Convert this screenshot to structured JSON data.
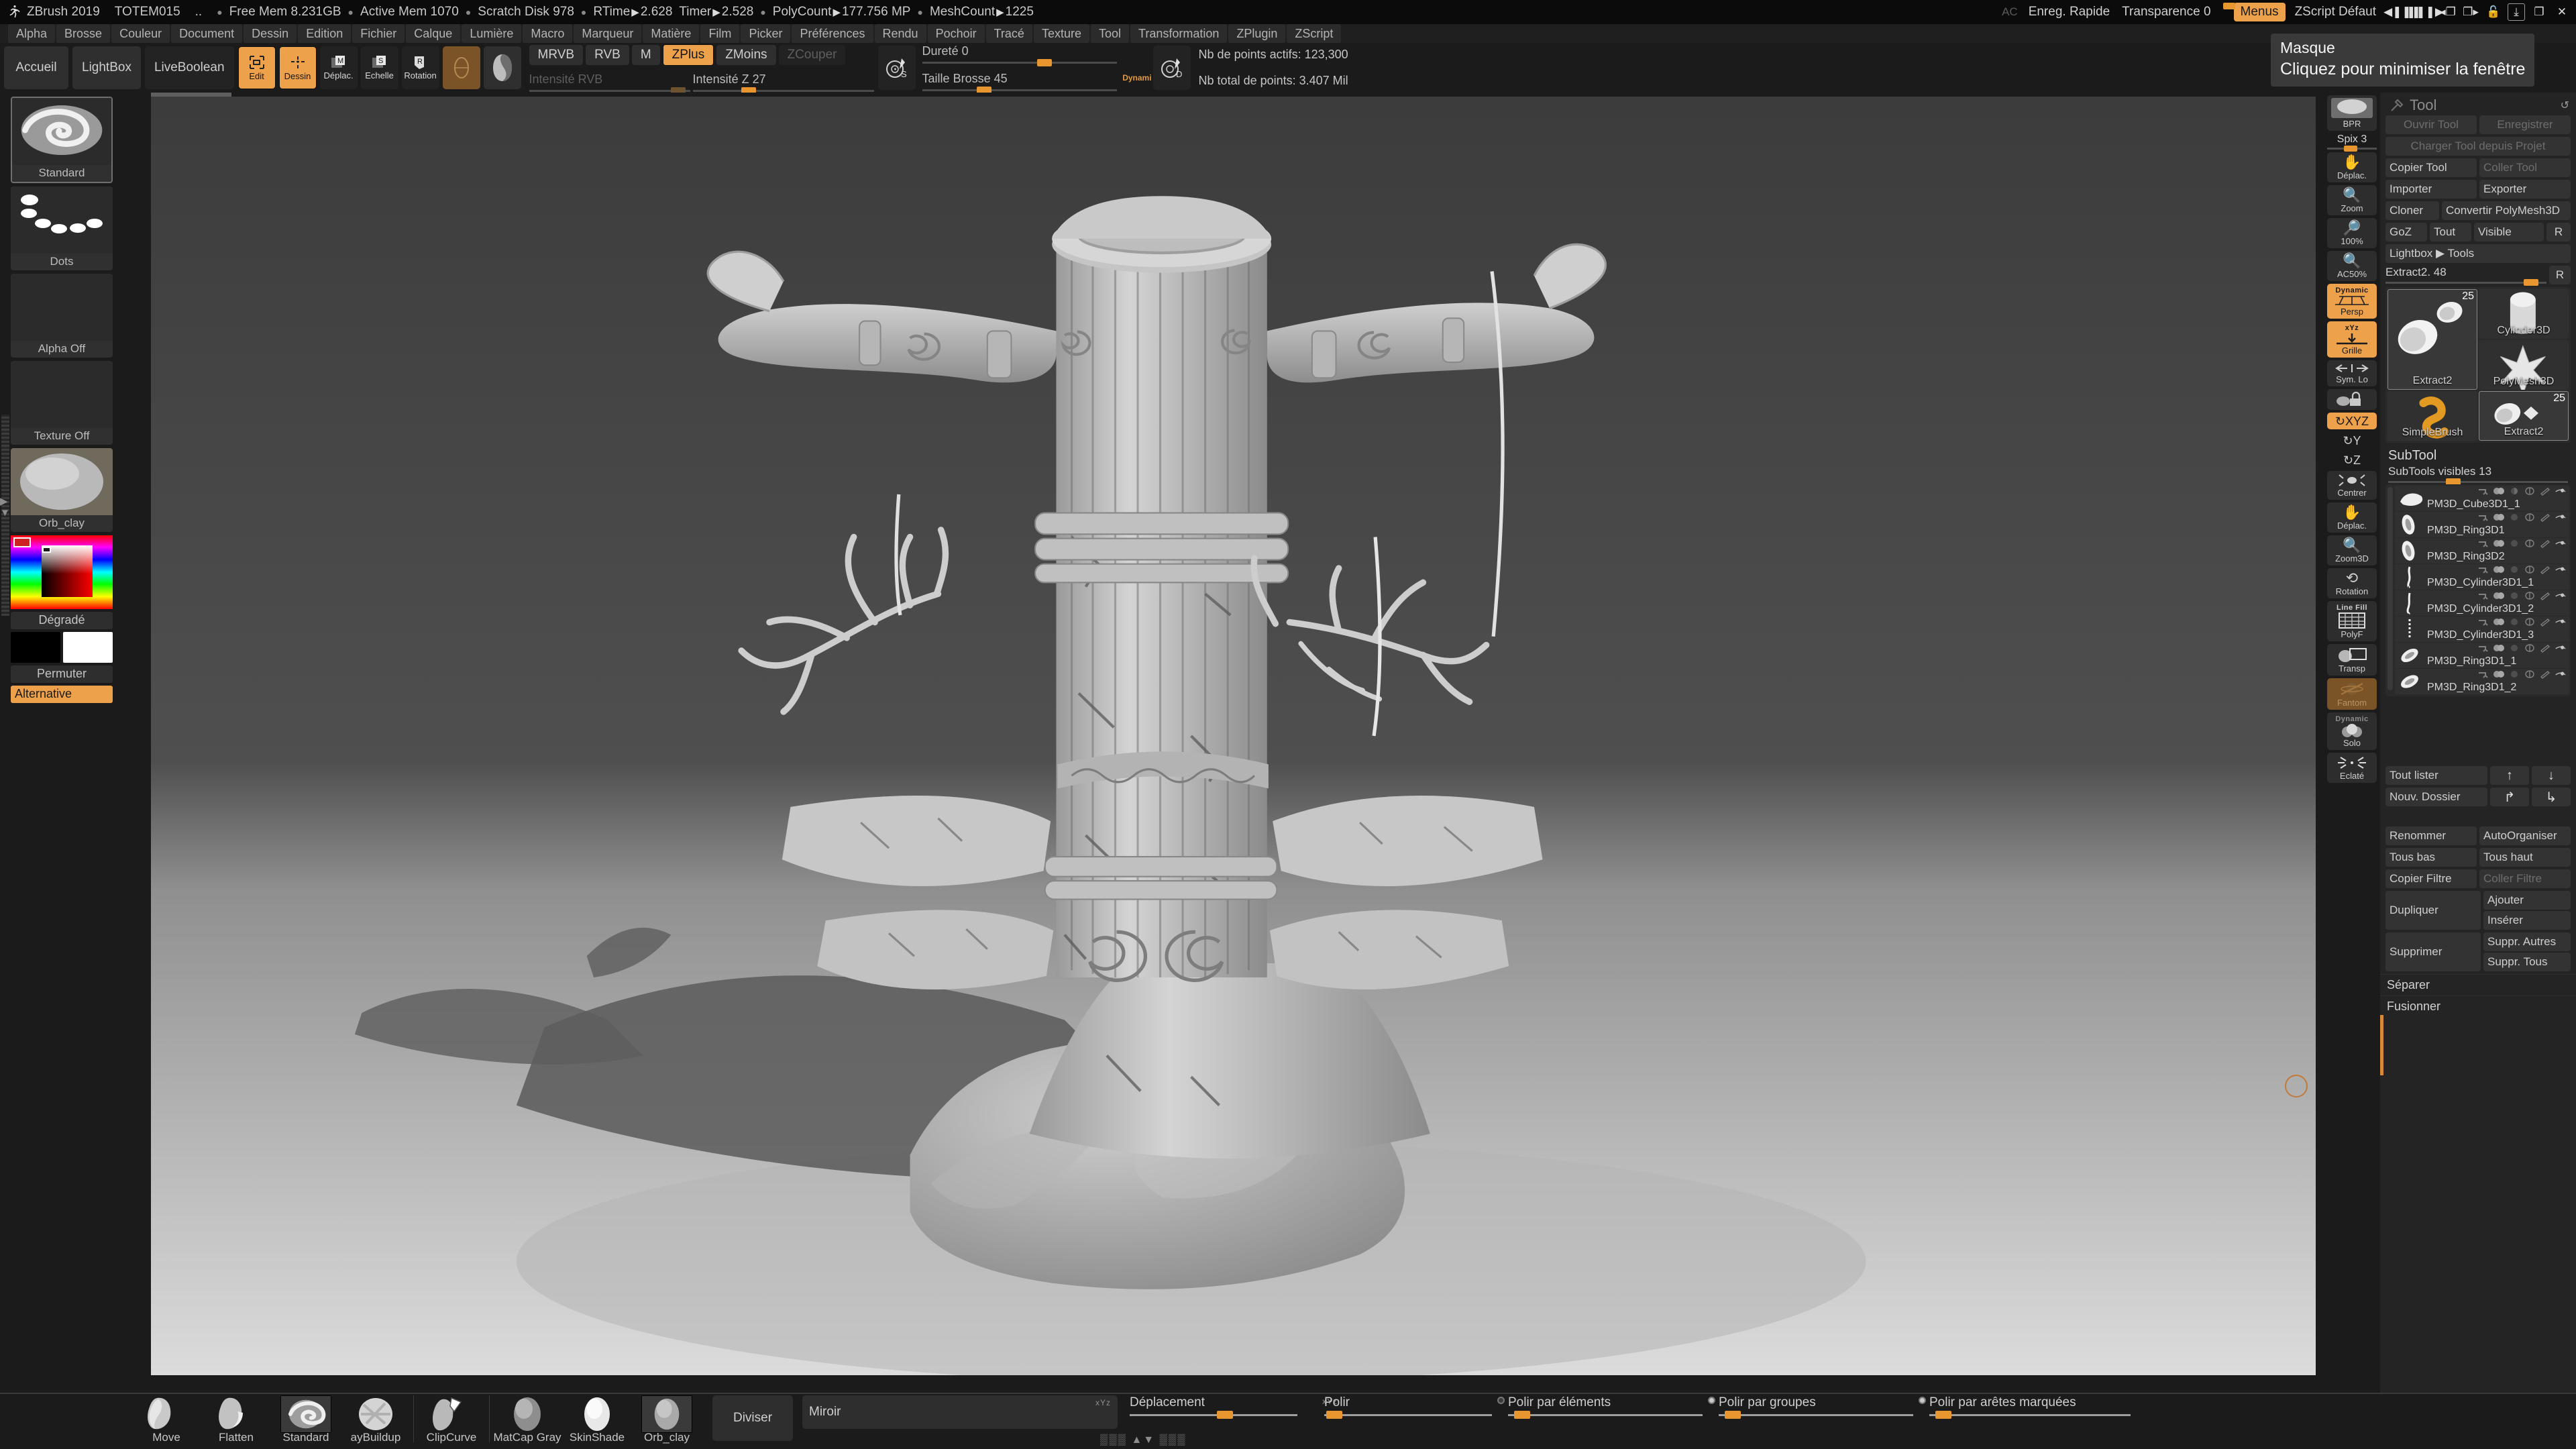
{
  "titlebar": {
    "app": "ZBrush 2019",
    "document": "TOTEM015",
    "ellipsis": "..",
    "stats": [
      {
        "label": "Free Mem",
        "value": "8.231GB"
      },
      {
        "label": "Active Mem",
        "value": "1070"
      },
      {
        "label": "Scratch Disk",
        "value": "978"
      }
    ],
    "timers": [
      {
        "label": "RTime",
        "value": "2.628"
      },
      {
        "label": "Timer",
        "value": "2.528"
      },
      {
        "label": "PolyCount",
        "value": "177.756 MP"
      },
      {
        "label": "MeshCount",
        "value": "1225"
      }
    ],
    "ac": "AC",
    "quicksave": "Enreg. Rapide",
    "transparency_label": "Transparence 0",
    "menus": "Menus",
    "zscript": "ZScript Défaut"
  },
  "menubar": {
    "items": [
      "Alpha",
      "Brosse",
      "Couleur",
      "Document",
      "Dessin",
      "Edition",
      "Fichier",
      "Calque",
      "Lumière",
      "Macro",
      "Marqueur",
      "Matière",
      "Film",
      "Picker",
      "Préférences",
      "Rendu",
      "Pochoir",
      "Tracé",
      "Texture",
      "Tool",
      "Transformation",
      "ZPlugin",
      "ZScript"
    ]
  },
  "topshelf": {
    "buttons": [
      "Accueil",
      "LightBox",
      "LiveBoolean"
    ],
    "mode_icons": [
      {
        "label": "Edit",
        "icon": "edit-icon",
        "active": true
      },
      {
        "label": "Dessin",
        "icon": "draw-icon",
        "active": true
      },
      {
        "label": "Déplac.",
        "icon": "move-icon",
        "active": false
      },
      {
        "label": "Echelle",
        "icon": "scale-icon",
        "active": false
      },
      {
        "label": "Rotation",
        "icon": "rotate-icon",
        "active": false
      }
    ],
    "color_modes": [
      "MRVB",
      "RVB",
      "M"
    ],
    "z_modes": [
      {
        "label": "ZPlus",
        "active": true
      },
      {
        "label": "ZMoins",
        "active": false
      },
      {
        "label": "ZCouper",
        "active": false,
        "disabled": true
      }
    ],
    "rgb_intensity_label": "Intensité RVB",
    "z_intensity_label": "Intensité Z 27",
    "hardness_label": "Dureté 0",
    "brush_size_label": "Taille Brosse 45",
    "dynamic_label": "Dynami",
    "active_points": "Nb de points actifs: 123,300",
    "total_points": "Nb total de points: 3.407 Mil"
  },
  "lefttray": {
    "cells": [
      {
        "name": "Standard",
        "type": "brush",
        "selected": true
      },
      {
        "name": "Dots",
        "type": "stroke"
      },
      {
        "name": "Alpha Off",
        "type": "alpha"
      },
      {
        "name": "Texture Off",
        "type": "texture"
      },
      {
        "name": "Orb_clay",
        "type": "material"
      }
    ],
    "gradient_label": "Dégradé",
    "swap_label": "Permuter",
    "alternative_label": "Alternative",
    "primary_color": "#000000",
    "secondary_color": "#ffffff",
    "accent_color": "#eda14a"
  },
  "rightshelf": {
    "bpr_label": "BPR",
    "spix_label": "Spix 3",
    "buttons": [
      {
        "label": "Déplac.",
        "icon": "hand-move-icon",
        "state": "normal"
      },
      {
        "label": "Zoom",
        "icon": "zoom-icon",
        "state": "normal"
      },
      {
        "label": "100%",
        "icon": "zoom-1x-icon",
        "state": "normal"
      },
      {
        "label": "AC50%",
        "icon": "zoom-halfsize-icon",
        "state": "normal"
      },
      {
        "label": "Persp",
        "icon": "perspective-icon",
        "state": "active",
        "tag": "Dynamic"
      },
      {
        "label": "Grille",
        "icon": "grid-icon",
        "state": "active",
        "tag": "xYz"
      },
      {
        "label": "Sym. Lo",
        "icon": "symmetry-icon",
        "state": "normal"
      },
      {
        "label": "",
        "icon": "lock-icon",
        "state": "normal"
      },
      {
        "label": "XYZ",
        "icon": "rotate-xyz-icon",
        "state": "active"
      },
      {
        "label": "Y",
        "icon": "rotate-y-icon",
        "state": "plain"
      },
      {
        "label": "Z",
        "icon": "rotate-z-icon",
        "state": "plain"
      },
      {
        "label": "Centrer",
        "icon": "center-icon",
        "state": "normal"
      },
      {
        "label": "Déplac.",
        "icon": "hand-drag-icon",
        "state": "normal"
      },
      {
        "label": "Zoom3D",
        "icon": "zoom3d-icon",
        "state": "normal"
      },
      {
        "label": "Rotation",
        "icon": "rotation-3d-icon",
        "state": "normal"
      },
      {
        "label": "PolyF",
        "icon": "polyframe-icon",
        "state": "normal",
        "tag": "Line Fill"
      },
      {
        "label": "Transp",
        "icon": "transparency-icon",
        "state": "normal"
      },
      {
        "label": "Fantom",
        "icon": "ghost-icon",
        "state": "brown"
      },
      {
        "label": "Solo",
        "icon": "solo-icon",
        "state": "normal",
        "tag": "Dynamic"
      },
      {
        "label": "Eclaté",
        "icon": "explode-icon",
        "state": "normal"
      }
    ]
  },
  "toolpanel": {
    "title": "Tool",
    "buttons_rows": [
      [
        {
          "label": "Ouvrir Tool",
          "dim": true
        },
        {
          "label": "Enregistrer",
          "dim": true
        }
      ],
      [
        {
          "label": "Charger Tool depuis Projet",
          "dim": true
        }
      ],
      [
        {
          "label": "Copier Tool",
          "dim": false
        },
        {
          "label": "Coller Tool",
          "dim": true
        }
      ],
      [
        {
          "label": "Importer",
          "dim": false
        },
        {
          "label": "Exporter",
          "dim": false
        }
      ],
      [
        {
          "label": "Cloner",
          "dim": false
        },
        {
          "label": "Convertir PolyMesh3D",
          "dim": false
        }
      ],
      [
        {
          "label": "GoZ",
          "dim": false
        },
        {
          "label": "Tout",
          "dim": false
        },
        {
          "label": "Visible",
          "dim": false
        },
        {
          "label": "R",
          "dim": false,
          "narrow": true
        }
      ],
      [
        {
          "label": "Lightbox ▶ Tools",
          "dim": false
        }
      ]
    ],
    "extract_slider": {
      "label": "Extract2. 48",
      "value": 48,
      "reset": "R"
    },
    "tool_grid": [
      {
        "label": "Extract2",
        "badge": "25",
        "selected": true,
        "icon": "cylinder-shell-icon",
        "tall": true
      },
      {
        "label": "Cylinder3D",
        "badge": "",
        "selected": false,
        "icon": "cylinder-icon"
      },
      {
        "label": "PolyMesh3D",
        "badge": "",
        "selected": false,
        "icon": "star-icon"
      },
      {
        "label": "SimpleBrush",
        "badge": "",
        "selected": false,
        "icon": "simplebrush-icon"
      },
      {
        "label": "Extract2",
        "badge": "25",
        "selected": true,
        "icon": "cylinder-shell-small-icon"
      }
    ],
    "subtool": {
      "title": "SubTool",
      "visible_label": "SubTools visibles 13",
      "visible_count": 13,
      "items": [
        {
          "name": "PM3D_Cube3D1_1",
          "thumb": "rock-thumb"
        },
        {
          "name": "PM3D_Ring3D1",
          "thumb": "ring-thumb"
        },
        {
          "name": "PM3D_Ring3D2",
          "thumb": "ring-thumb"
        },
        {
          "name": "PM3D_Cylinder3D1_1",
          "thumb": "wire-thumb"
        },
        {
          "name": "PM3D_Cylinder3D1_2",
          "thumb": "wire-thumb"
        },
        {
          "name": "PM3D_Cylinder3D1_3",
          "thumb": "dotted-wire-thumb"
        },
        {
          "name": "PM3D_Ring3D1_1",
          "thumb": "ring-flat-thumb"
        },
        {
          "name": "PM3D_Ring3D1_2",
          "thumb": "ring-flat-thumb"
        }
      ]
    },
    "list_buttons": [
      [
        {
          "label": "Tout lister"
        },
        {
          "label": "↑",
          "arrow": true
        },
        {
          "label": "↓",
          "arrow": true
        }
      ],
      [
        {
          "label": "Nouv. Dossier"
        },
        {
          "label": "↱",
          "arrow": true
        },
        {
          "label": "↳",
          "arrow": true
        }
      ]
    ],
    "ops": [
      [
        {
          "label": "Renommer"
        },
        {
          "label": "AutoOrganiser"
        }
      ],
      [
        {
          "label": "Tous bas"
        },
        {
          "label": "Tous haut"
        }
      ],
      [
        {
          "label": "Copier Filtre"
        },
        {
          "label": "Coller Filtre",
          "dim": true
        }
      ]
    ],
    "duplicate": {
      "label": "Dupliquer",
      "options": [
        "Ajouter",
        "Insérer"
      ]
    },
    "delete": {
      "label": "Supprimer",
      "options": [
        "Suppr. Autres",
        "Suppr. Tous"
      ]
    },
    "flat_rows": [
      "Séparer",
      "Fusionner"
    ]
  },
  "bottomshelf": {
    "brushes": [
      {
        "label": "Move",
        "selected": false
      },
      {
        "label": "Flatten",
        "selected": false
      },
      {
        "label": "Standard",
        "selected": true
      },
      {
        "label": "ayBuildup",
        "selected": false
      },
      {
        "label": "ClipCurve",
        "selected": false
      },
      {
        "label": "MatCap Gray",
        "selected": false
      },
      {
        "label": "SkinShade",
        "selected": false
      },
      {
        "label": "Orb_clay",
        "selected": true
      }
    ],
    "divide_button": "Diviser",
    "mirror_field": {
      "label": "Miroir",
      "axis": "xYz"
    },
    "sliders": [
      {
        "label": "Déplacement",
        "axis": "xYz",
        "value": 28
      },
      {
        "label": "Polir",
        "value": 2
      },
      {
        "label": "Polir par éléments",
        "value": 5,
        "radio": "open"
      },
      {
        "label": "Polir par groupes",
        "value": 5,
        "radio": "filled"
      },
      {
        "label": "Polir par arêtes marquées",
        "value": 5,
        "radio": "filled"
      }
    ]
  },
  "tooltip": {
    "title": "Masque",
    "body": "Cliquez pour minimiser la fenêtre"
  }
}
